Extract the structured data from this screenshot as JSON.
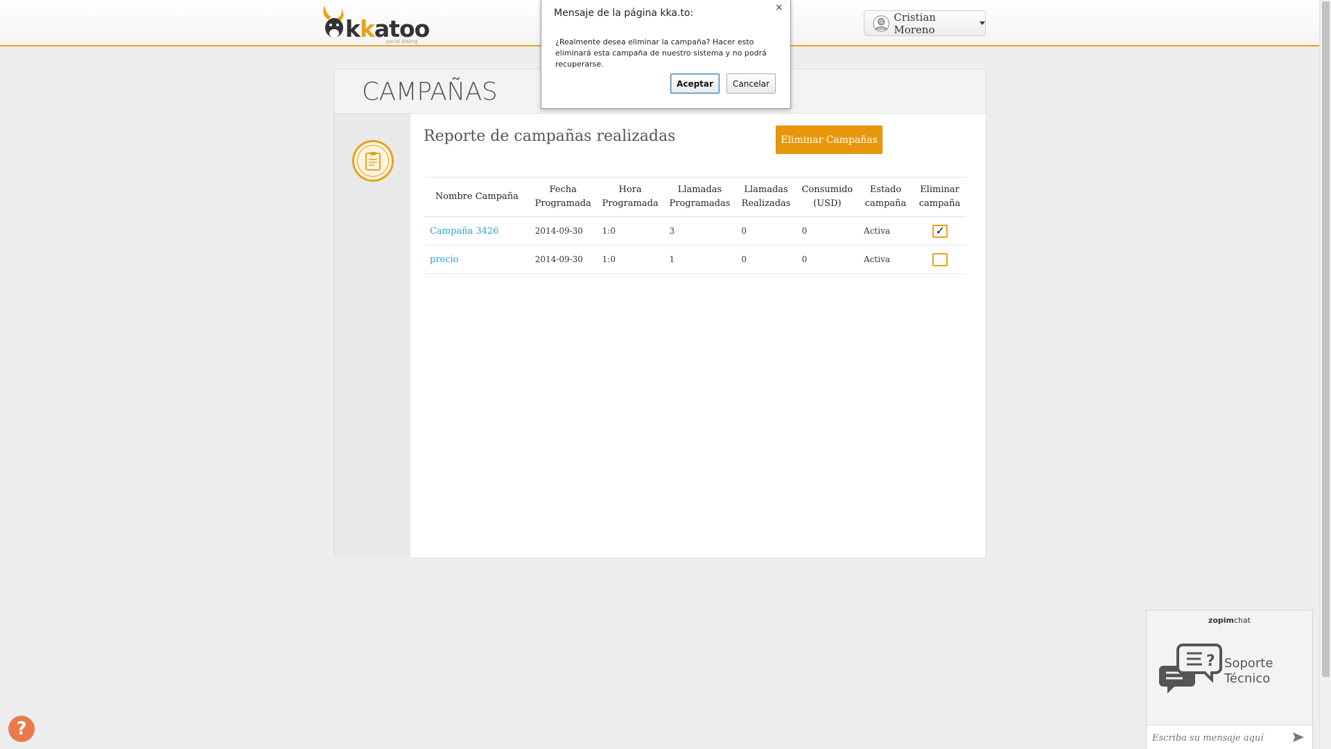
{
  "header": {
    "logo_text_a": "k",
    "logo_text_b": "k",
    "logo_text_c": "atoo",
    "logo_tagline": "social dialing",
    "user_name": "Cristian Moreno"
  },
  "page": {
    "title": "CAMPAÑAS",
    "section_title": "Reporte de campañas realizadas",
    "delete_button": "Eliminar Campañas"
  },
  "table": {
    "headers": [
      "Nombre Campaña",
      "Fecha Programada",
      "Hora Programada",
      "Llamadas Programadas",
      "Llamadas Realizadas",
      "Consumido (USD)",
      "Estado campaña",
      "Eliminar campaña"
    ],
    "rows": [
      {
        "name": "Campaña 3426",
        "date": "2014-09-30",
        "time": "1:0",
        "scheduled_calls": "3",
        "made_calls": "0",
        "consumed": "0",
        "status": "Activa",
        "delete_checked": true
      },
      {
        "name": "precio",
        "date": "2014-09-30",
        "time": "1:0",
        "scheduled_calls": "1",
        "made_calls": "0",
        "consumed": "0",
        "status": "Activa",
        "delete_checked": false
      }
    ]
  },
  "dialog": {
    "title": "Mensaje de la página kka.to:",
    "close": "×",
    "message": "¿Realmente desea eliminar la campaña? Hacer esto eliminará esta campaña de nuestro sistema y no podrá recuperarse.",
    "ok_label": "Aceptar",
    "cancel_label": "Cancelar"
  },
  "help": {
    "label": "?"
  },
  "chat": {
    "brand_bold": "zopim",
    "brand_rest": "chat",
    "title_line1": "Soporte",
    "title_line2": "Técnico",
    "placeholder": "Escriba su mensaje aquí"
  },
  "colors": {
    "accent": "#e8a21a",
    "link": "#2a9fd6",
    "help": "#e97a4a"
  },
  "icons": {
    "user": "user-avatar-icon",
    "side": "clipboard-icon",
    "chat": "chat-bubbles-icon",
    "send": "send-arrow-icon"
  }
}
